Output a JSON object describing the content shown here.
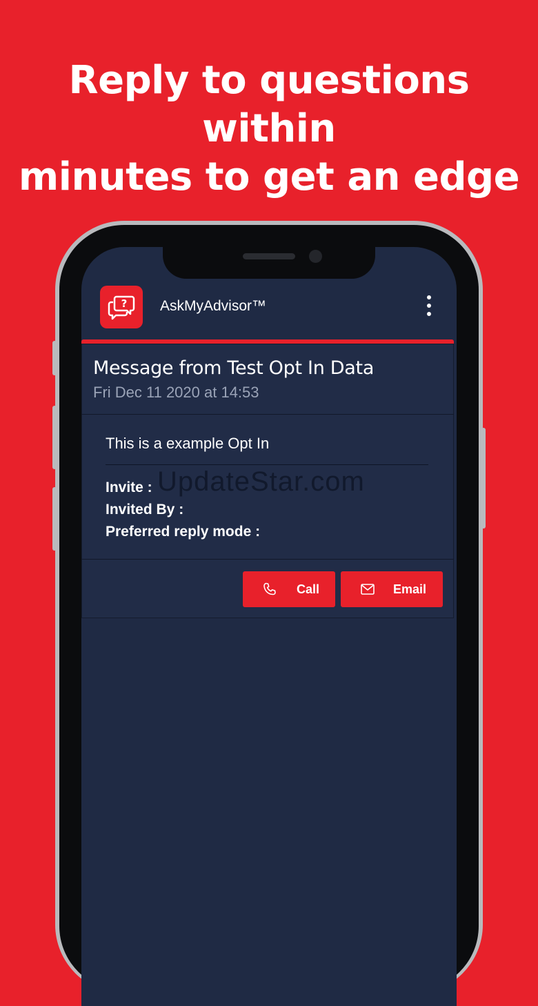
{
  "headline": {
    "line1": "Reply to questions within",
    "line2": "minutes to get an edge"
  },
  "app_bar": {
    "title": "AskMyAdvisor™",
    "logo_icon": "chat-question-icon",
    "menu_icon": "more-vert-icon"
  },
  "message": {
    "title": "Message from Test Opt In Data",
    "date": "Fri Dec 11 2020 at 14:53",
    "body": "This is a example Opt In",
    "fields": [
      {
        "label": "Invite :"
      },
      {
        "label": "Invited By :"
      },
      {
        "label": "Preferred reply mode :"
      }
    ],
    "watermark": "UpdateStar.com"
  },
  "actions": {
    "call_label": "Call",
    "email_label": "Email",
    "call_icon": "phone-icon",
    "email_icon": "mail-icon"
  },
  "colors": {
    "background": "#e8212b",
    "screen": "#1f2a44",
    "accent": "#e8212b"
  }
}
